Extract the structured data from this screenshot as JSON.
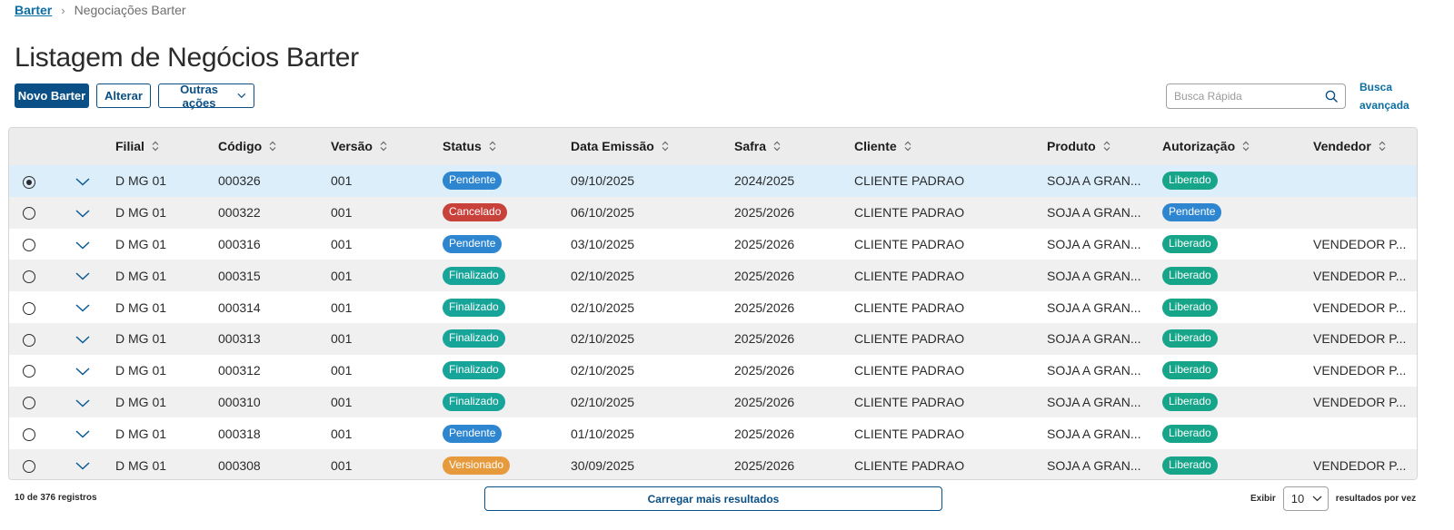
{
  "breadcrumb": {
    "root": "Barter",
    "current": "Negociações Barter"
  },
  "page": {
    "title": "Listagem de Negócios Barter"
  },
  "actions": {
    "new_label": "Novo Barter",
    "edit_label": "Alterar",
    "more_label": "Outras ações"
  },
  "search": {
    "placeholder": "Busca Rápida",
    "advanced_label_line1": "Busca",
    "advanced_label_line2": "avançada"
  },
  "colors": {
    "primary": "#0a4f85",
    "status": {
      "Pendente": "#2e86d0",
      "Cancelado": "#c8413a",
      "Finalizado": "#17a59a",
      "Versionado": "#e79a3c",
      "Liberado": "#17a589"
    }
  },
  "table": {
    "columns": [
      "Filial",
      "Código",
      "Versão",
      "Status",
      "Data Emissão",
      "Safra",
      "Cliente",
      "Produto",
      "Autorização",
      "Vendedor"
    ],
    "rows": [
      {
        "selected": true,
        "filial": "D MG 01",
        "codigo": "000326",
        "versao": "001",
        "status": "Pendente",
        "data": "09/10/2025",
        "safra": "2024/2025",
        "cliente": "CLIENTE PADRAO",
        "produto": "SOJA A GRAN...",
        "autorizacao": "Liberado",
        "vendedor": ""
      },
      {
        "selected": false,
        "filial": "D MG 01",
        "codigo": "000322",
        "versao": "001",
        "status": "Cancelado",
        "data": "06/10/2025",
        "safra": "2025/2026",
        "cliente": "CLIENTE PADRAO",
        "produto": "SOJA A GRAN...",
        "autorizacao": "Pendente",
        "vendedor": ""
      },
      {
        "selected": false,
        "filial": "D MG 01",
        "codigo": "000316",
        "versao": "001",
        "status": "Pendente",
        "data": "03/10/2025",
        "safra": "2025/2026",
        "cliente": "CLIENTE PADRAO",
        "produto": "SOJA A GRAN...",
        "autorizacao": "Liberado",
        "vendedor": "VENDEDOR P..."
      },
      {
        "selected": false,
        "filial": "D MG 01",
        "codigo": "000315",
        "versao": "001",
        "status": "Finalizado",
        "data": "02/10/2025",
        "safra": "2025/2026",
        "cliente": "CLIENTE PADRAO",
        "produto": "SOJA A GRAN...",
        "autorizacao": "Liberado",
        "vendedor": "VENDEDOR P..."
      },
      {
        "selected": false,
        "filial": "D MG 01",
        "codigo": "000314",
        "versao": "001",
        "status": "Finalizado",
        "data": "02/10/2025",
        "safra": "2025/2026",
        "cliente": "CLIENTE PADRAO",
        "produto": "SOJA A GRAN...",
        "autorizacao": "Liberado",
        "vendedor": "VENDEDOR P..."
      },
      {
        "selected": false,
        "filial": "D MG 01",
        "codigo": "000313",
        "versao": "001",
        "status": "Finalizado",
        "data": "02/10/2025",
        "safra": "2025/2026",
        "cliente": "CLIENTE PADRAO",
        "produto": "SOJA A GRAN...",
        "autorizacao": "Liberado",
        "vendedor": "VENDEDOR P..."
      },
      {
        "selected": false,
        "filial": "D MG 01",
        "codigo": "000312",
        "versao": "001",
        "status": "Finalizado",
        "data": "02/10/2025",
        "safra": "2025/2026",
        "cliente": "CLIENTE PADRAO",
        "produto": "SOJA A GRAN...",
        "autorizacao": "Liberado",
        "vendedor": "VENDEDOR P..."
      },
      {
        "selected": false,
        "filial": "D MG 01",
        "codigo": "000310",
        "versao": "001",
        "status": "Finalizado",
        "data": "02/10/2025",
        "safra": "2025/2026",
        "cliente": "CLIENTE PADRAO",
        "produto": "SOJA A GRAN...",
        "autorizacao": "Liberado",
        "vendedor": "VENDEDOR P..."
      },
      {
        "selected": false,
        "filial": "D MG 01",
        "codigo": "000318",
        "versao": "001",
        "status": "Pendente",
        "data": "01/10/2025",
        "safra": "2025/2026",
        "cliente": "CLIENTE PADRAO",
        "produto": "SOJA A GRAN...",
        "autorizacao": "Liberado",
        "vendedor": ""
      },
      {
        "selected": false,
        "filial": "D MG 01",
        "codigo": "000308",
        "versao": "001",
        "status": "Versionado",
        "data": "30/09/2025",
        "safra": "2025/2026",
        "cliente": "CLIENTE PADRAO",
        "produto": "SOJA A GRAN...",
        "autorizacao": "Liberado",
        "vendedor": "VENDEDOR P..."
      }
    ]
  },
  "footer": {
    "count_label": "10 de 376 registros",
    "load_more_label": "Carregar mais resultados",
    "show_label": "Exibir",
    "page_size": "10",
    "per_page_label": "resultados por vez"
  }
}
